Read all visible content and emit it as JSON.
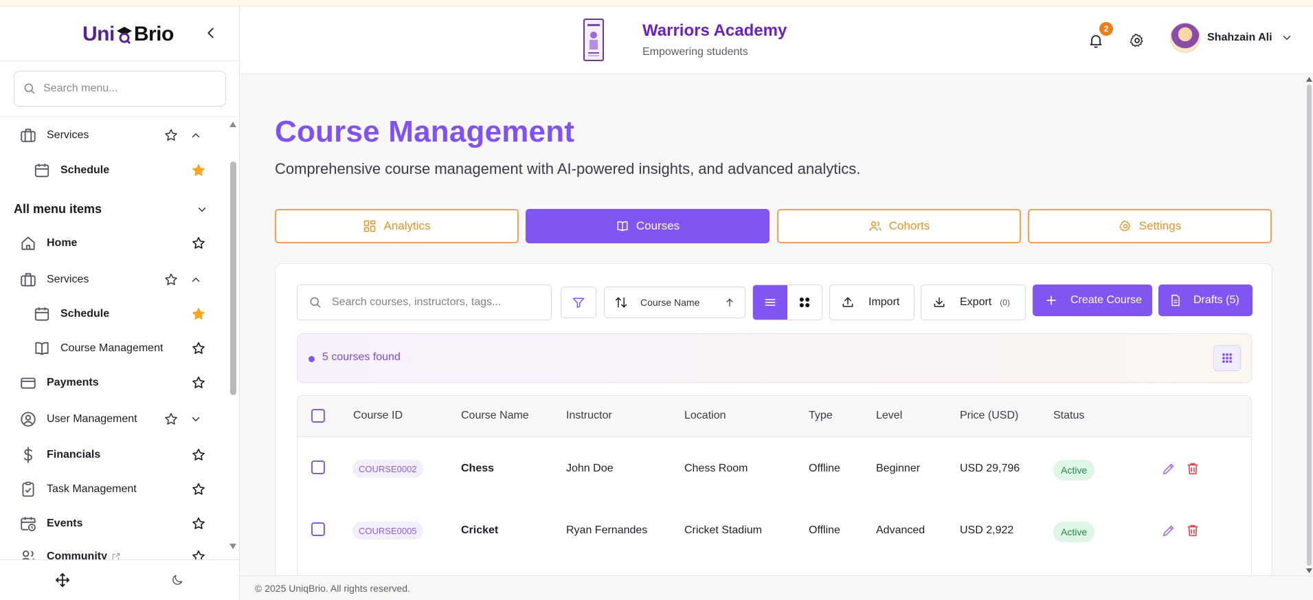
{
  "app": {
    "logo_part1": "Uni",
    "logo_part2": "Brio",
    "colors": {
      "primary": "#8155f2",
      "accent": "#ef8f1c",
      "title": "#6c1fc6",
      "active_status": "#1c8a45"
    }
  },
  "sidebar": {
    "search_placeholder": "Search menu...",
    "favorites": [
      {
        "label": "Services",
        "icon": "briefcase-icon"
      },
      {
        "label": "Schedule",
        "icon": "calendar-icon"
      }
    ],
    "section_title": "All menu items",
    "items": [
      {
        "label": "Home",
        "icon": "home-icon"
      },
      {
        "label": "Services",
        "icon": "briefcase-icon"
      },
      {
        "label": "Schedule",
        "icon": "calendar-icon"
      },
      {
        "label": "Course Management",
        "icon": "book-icon"
      },
      {
        "label": "Payments",
        "icon": "credit-card-icon"
      },
      {
        "label": "User Management",
        "icon": "user-circle-icon"
      },
      {
        "label": "Financials",
        "icon": "dollar-icon"
      },
      {
        "label": "Task Management",
        "icon": "clipboard-check-icon"
      },
      {
        "label": "Events",
        "icon": "calendar-clock-icon"
      },
      {
        "label": "Community",
        "icon": "users-icon"
      }
    ]
  },
  "header": {
    "academy_name": "Warriors Academy",
    "academy_tagline": "Empowering students",
    "notification_count": "2",
    "user_name": "Shahzain Ali"
  },
  "page": {
    "title": "Course Management",
    "description": "Comprehensive course management with AI-powered insights, and advanced analytics.",
    "tabs": [
      {
        "label": "Analytics",
        "icon": "grid-icon"
      },
      {
        "label": "Courses",
        "icon": "book-open-icon"
      },
      {
        "label": "Cohorts",
        "icon": "users-icon"
      },
      {
        "label": "Settings",
        "icon": "gear-icon"
      }
    ],
    "active_tab": "Courses"
  },
  "toolbar": {
    "search_placeholder": "Search courses, instructors, tags...",
    "sort_label": "Course Name",
    "import_label": "Import",
    "export_label": "Export",
    "export_count": "(0)",
    "create_label": "Create Course",
    "drafts_label": "Drafts (5)"
  },
  "results": {
    "found_text": "5 courses found"
  },
  "table": {
    "columns": [
      "Course ID",
      "Course Name",
      "Instructor",
      "Location",
      "Type",
      "Level",
      "Price (USD)",
      "Status"
    ],
    "rows": [
      {
        "id": "COURSE0002",
        "name": "Chess",
        "instructor": "John Doe",
        "location": "Chess Room",
        "type": "Offline",
        "level": "Beginner",
        "price": "USD 29,796",
        "status": "Active"
      },
      {
        "id": "COURSE0005",
        "name": "Cricket",
        "instructor": "Ryan Fernandes",
        "location": "Cricket Stadium",
        "type": "Offline",
        "level": "Advanced",
        "price": "USD 2,922",
        "status": "Active"
      }
    ]
  },
  "footer": {
    "copyright": "© 2025 UniqBrio. All rights reserved."
  }
}
